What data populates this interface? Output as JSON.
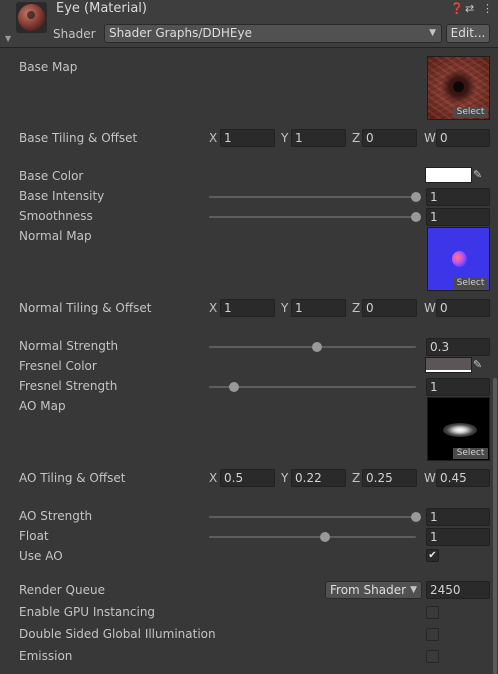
{
  "header": {
    "title": "Eye (Material)",
    "shader_label": "Shader",
    "shader_value": "Shader Graphs/DDHEye",
    "edit_label": "Edit...",
    "help_icon": "help-icon",
    "settings_icon": "preset-sliders-icon",
    "menu_icon": "kebab-menu-icon"
  },
  "properties": {
    "base_map": {
      "label": "Base Map",
      "select": "Select"
    },
    "base_tiling": {
      "label": "Base Tiling & Offset",
      "x": "1",
      "y": "1",
      "z": "0",
      "w": "0"
    },
    "base_color": {
      "label": "Base Color",
      "color": "#ffffff"
    },
    "base_intensity": {
      "label": "Base Intensity",
      "value": "1",
      "slider": 1.0
    },
    "smoothness": {
      "label": "Smoothness",
      "value": "1",
      "slider": 1.0
    },
    "normal_map": {
      "label": "Normal Map",
      "select": "Select"
    },
    "normal_tiling": {
      "label": "Normal Tiling & Offset",
      "x": "1",
      "y": "1",
      "z": "0",
      "w": "0"
    },
    "normal_strength": {
      "label": "Normal Strength",
      "value": "0.3",
      "slider": 0.52
    },
    "fresnel_color": {
      "label": "Fresnel Color",
      "color": "#5c5557"
    },
    "fresnel_strength": {
      "label": "Fresnel Strength",
      "value": "1",
      "slider": 0.12
    },
    "ao_map": {
      "label": "AO Map",
      "select": "Select"
    },
    "ao_tiling": {
      "label": "AO Tiling & Offset",
      "x": "0.5",
      "y": "0.22",
      "z": "0.25",
      "w": "0.45"
    },
    "ao_strength": {
      "label": "AO Strength",
      "value": "1",
      "slider": 1.0
    },
    "float": {
      "label": "Float",
      "value": "1",
      "slider": 0.56
    },
    "use_ao": {
      "label": "Use AO",
      "checked": true
    }
  },
  "footer": {
    "render_queue": {
      "label": "Render Queue",
      "mode": "From Shader",
      "value": "2450"
    },
    "gpu_instancing": {
      "label": "Enable GPU Instancing",
      "checked": false
    },
    "double_sided_gi": {
      "label": "Double Sided Global Illumination",
      "checked": false
    },
    "emission": {
      "label": "Emission",
      "checked": false
    }
  },
  "axes": {
    "x": "X",
    "y": "Y",
    "z": "Z",
    "w": "W"
  },
  "icons": {
    "picker": "eyedropper-icon",
    "check": "✔"
  },
  "colors": {
    "background": "#383838",
    "field": "#2a2a2a",
    "normal_tex": "#3c36e8"
  }
}
